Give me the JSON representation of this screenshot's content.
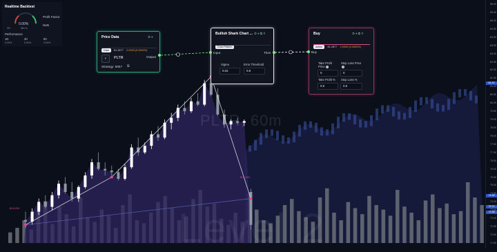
{
  "accent_colors": {
    "bull": "#ffffff",
    "bear": "#8f96a3",
    "area": "#3b2d78",
    "node_green": "#35c26b",
    "node_pink": "#e04a8a",
    "flow": "#7df08a"
  },
  "watermark": {
    "symbol": "PLTR, 60m",
    "brand": "Level 2"
  },
  "y_axis": {
    "ticks": [
      "86.00",
      "85.50",
      "85.00",
      "84.50",
      "84.00",
      "83.50",
      "83.00",
      "82.50",
      "82.00",
      "81.50",
      "81.00",
      "80.50",
      "80.00",
      "79.50",
      "79.00",
      "78.50",
      "78.00",
      "77.50",
      "77.00",
      "76.50",
      "76.00",
      "75.50",
      "75.00",
      "74.50",
      "74.00",
      "73.50",
      "73.00",
      "72.50",
      "72.00",
      "71.50"
    ],
    "tags": [
      {
        "text": "81.20",
        "color": "#2d56c8"
      },
      {
        "text": "74.38",
        "color": "#2d56c8"
      },
      {
        "text": "73.71",
        "color": "#2d56c8"
      },
      {
        "text": "73.38",
        "color": "#2d56c8"
      }
    ]
  },
  "backtest": {
    "title": "Realtime Backtest",
    "profit_factor_label": "Profit Factor",
    "profit_factor_value": "NaN",
    "gauge_value": "0.00%",
    "gauge_sub": "Win %",
    "gauge_min": "0%",
    "performance_label": "Performance",
    "periods": [
      {
        "label": "1D",
        "value": "0.00%"
      },
      {
        "label": "30",
        "value": "0.00%"
      },
      {
        "label": "60",
        "value": "0.00%"
      }
    ]
  },
  "price_node": {
    "title": "Price Data",
    "chip": "Data",
    "price": "81.2877",
    "change": "0.0000 (0.0000%)",
    "output_label": "Output",
    "ticker": "PLTR",
    "ticker_icon_text": "P",
    "strategy_label": "Strategy: 6657",
    "icons": [
      "settings-icon",
      "status-icon"
    ]
  },
  "pattern_node": {
    "title": "Bullish Shark Chart ...",
    "chip": "Chart Pattern",
    "input_label": "Input",
    "then_label": "Then",
    "sigma_label": "Sigma",
    "sigma_value": "0.02",
    "error_label": "Error Threshold",
    "error_value": "0.8",
    "icons": [
      "settings-icon",
      "status-icon",
      "copy-icon",
      "close-icon"
    ]
  },
  "buy_node": {
    "title": "Buy",
    "chip": "Action",
    "price": "81.2877",
    "change": "0.0000 (0.0000%)",
    "input_label": "Buy",
    "take_profit_price_label": "Take Profit Price",
    "take_profit_price_value": "0",
    "stop_loss_price_label": "Stop Loss Price",
    "stop_loss_price_value": "0",
    "take_profit_pct_label": "Take Profit %",
    "take_profit_pct_value": "0.5",
    "stop_loss_pct_label": "Stop Loss %",
    "stop_loss_pct_value": "0.5",
    "icons": [
      "settings-icon",
      "status-icon",
      "copy-icon",
      "close-icon"
    ]
  },
  "pattern_labels": {
    "start": "BULLISH",
    "end": "BULLISH"
  },
  "chart_data": {
    "type": "candlestick",
    "ylim": [
      71.5,
      86.0
    ],
    "candles": [
      [
        72.9,
        73.4,
        72.4,
        72.8
      ],
      [
        72.8,
        73.6,
        72.6,
        73.4
      ],
      [
        73.4,
        74.2,
        73.2,
        74.0
      ],
      [
        74.0,
        74.4,
        73.6,
        73.7
      ],
      [
        73.7,
        74.6,
        73.5,
        74.4
      ],
      [
        74.4,
        75.3,
        74.2,
        75.1
      ],
      [
        75.1,
        75.5,
        74.5,
        74.6
      ],
      [
        74.6,
        75.2,
        74.0,
        74.2
      ],
      [
        74.2,
        75.0,
        74.0,
        74.9
      ],
      [
        74.9,
        75.8,
        74.8,
        75.6
      ],
      [
        75.6,
        76.6,
        75.4,
        76.4
      ],
      [
        76.4,
        77.0,
        75.9,
        76.0
      ],
      [
        76.0,
        76.4,
        75.6,
        75.9
      ],
      [
        75.9,
        76.2,
        75.6,
        75.8
      ],
      [
        75.8,
        76.0,
        75.3,
        75.4
      ],
      [
        75.4,
        76.3,
        75.3,
        76.1
      ],
      [
        76.1,
        77.5,
        76.0,
        77.3
      ],
      [
        77.3,
        77.9,
        76.8,
        77.0
      ],
      [
        77.0,
        77.6,
        76.9,
        77.4
      ],
      [
        77.4,
        78.3,
        77.2,
        78.1
      ],
      [
        78.1,
        78.6,
        77.7,
        77.9
      ],
      [
        77.9,
        79.0,
        77.8,
        78.8
      ],
      [
        78.8,
        79.4,
        78.4,
        79.1
      ],
      [
        79.1,
        79.9,
        78.9,
        79.7
      ],
      [
        79.7,
        80.1,
        79.3,
        79.5
      ],
      [
        79.5,
        80.3,
        79.4,
        80.1
      ],
      [
        80.1,
        80.6,
        79.8,
        79.9
      ],
      [
        79.9,
        81.4,
        79.8,
        81.2
      ],
      [
        81.2,
        81.8,
        80.4,
        80.5
      ],
      [
        80.5,
        80.9,
        79.2,
        79.3
      ],
      [
        79.3,
        79.6,
        78.5,
        78.7
      ],
      [
        78.7,
        79.0,
        78.4,
        78.9
      ],
      [
        78.9,
        79.1,
        78.7,
        78.8
      ],
      [
        78.8,
        79.0,
        78.6,
        78.9
      ],
      [
        74.6,
        74.8,
        72.3,
        72.6
      ]
    ],
    "pattern_lines": [
      {
        "from": [
          0,
          72.6
        ],
        "to": [
          13,
          75.5
        ]
      },
      {
        "from": [
          13,
          75.5
        ],
        "to": [
          28,
          81.6
        ]
      },
      {
        "from": [
          28,
          81.6
        ],
        "to": [
          34,
          74.2
        ]
      },
      {
        "from": [
          0,
          72.6
        ],
        "to": [
          34,
          74.2
        ]
      }
    ]
  }
}
